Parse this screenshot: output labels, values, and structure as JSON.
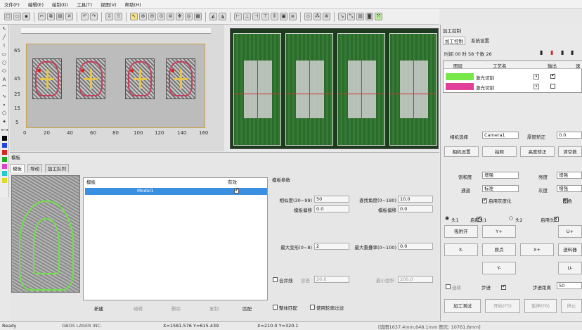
{
  "menus": [
    "文件(F)",
    "编辑(E)",
    "绘制(D)",
    "工具(T)",
    "视图(V)",
    "帮助(H)"
  ],
  "canvas": {
    "y_ticks": [
      "65",
      "45",
      "25",
      "15",
      "5"
    ],
    "x_ticks": [
      "0",
      "20",
      "40",
      "60",
      "80",
      "100",
      "120",
      "140",
      "160"
    ]
  },
  "panel_title": "模板",
  "panel_tabs": [
    "模板",
    "导动",
    "加工队列"
  ],
  "template_list": {
    "header_name": "模板",
    "header_valid": "有效",
    "row_name": "Model1",
    "buttons": [
      "新建",
      "编辑",
      "删除",
      "复制",
      "匹配"
    ]
  },
  "params": {
    "title": "模板参数",
    "similarity_label": "相似度(30~99)",
    "similarity_value": "50",
    "search_angle_label": "查找角度(0~180)",
    "search_angle_value": "10.0",
    "template_offset_label": "模板偏移",
    "template_offset_value": "0.0",
    "template_offset2_label": "模板偏移",
    "template_offset2_value": "0.0",
    "max_deform_label": "最大变形(0~8)",
    "max_deform_value": "2",
    "max_overlap_label": "最大重叠率(0~100)",
    "max_overlap_value": "0.0",
    "merge_label": "合并线",
    "merge_sub_label": "容差",
    "merge_value": "20.0",
    "min_area_label": "最小面积",
    "min_area_value": "200.0",
    "whole_match_label": "整体匹配",
    "contour_filter_label": "使用轮廓过滤"
  },
  "right_panel": {
    "title": "加工控制",
    "tabs": [
      "加工控制",
      "系统设置"
    ],
    "time": "时间 00 时 58 个数 26",
    "layer_header": [
      "图层",
      "工艺名",
      "输出",
      "速"
    ],
    "layers": [
      {
        "color": "#77e84a",
        "name": "激光切割",
        "output": true
      },
      {
        "color": "#e0409a",
        "name": "激光切割",
        "output": false
      }
    ],
    "camera_select_label": "相机选择",
    "camera_select_value": "Camera1",
    "thickness_label": "厚度矫正",
    "thickness_value": "0.0",
    "btn_camera_settings": "相机设置",
    "btn_capture": "拍照",
    "btn_height_correction": "高度矫正",
    "btn_clear": "清空数",
    "saturation_label": "饱和度",
    "saturation_value": "增强",
    "brightness_label": "亮度",
    "brightness_value": "增强",
    "channel_label": "通道",
    "channel_value": "标准",
    "gray_label": "灰度",
    "gray_value": "增强",
    "enable_gray_label": "启用灰度化",
    "invert_label": "反色",
    "head1_label": "头1",
    "enable_head1_label": "启用头1",
    "head2_label": "头2",
    "enable_head2_label": "启用头2",
    "btn_open_door": "吸附开",
    "btn_y_plus": "Y+",
    "btn_u_plus": "U+",
    "btn_x_minus": "X-",
    "btn_origin": "原点",
    "btn_x_plus": "X+",
    "btn_feed": "送料器",
    "btn_y_minus": "Y-",
    "btn_u_minus": "U-",
    "cont_label": "连续",
    "step_label": "步进",
    "step_dist_label": "步进距离",
    "step_value": "50",
    "btn_test": "加工测试",
    "btn_start": "开始(F5)",
    "btn_pause": "暂停(F6)",
    "btn_stop": "停止"
  },
  "status": {
    "ready": "Ready",
    "brand": "GBOS LASER INC.",
    "coord1": "X=1581.576 Y=615.439",
    "coord2": "X=210.0 Y=320.1",
    "info": "[选图1637.4mm,648.1mm 图元: 10761.8mm]"
  }
}
